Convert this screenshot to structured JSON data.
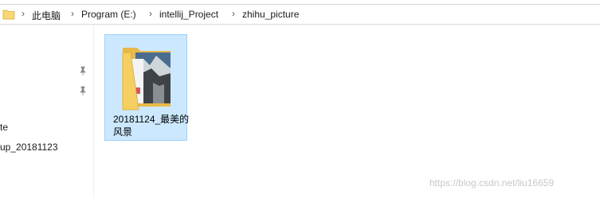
{
  "breadcrumb": {
    "items": [
      "此电脑",
      "Program (E:)",
      "intellij_Project",
      "zhihu_picture"
    ]
  },
  "nav": {
    "items": [
      "te",
      "up_20181123"
    ]
  },
  "files": [
    {
      "name": "20181124_最美的风景"
    }
  ],
  "watermark": "https://blog.csdn.net/liu16659"
}
